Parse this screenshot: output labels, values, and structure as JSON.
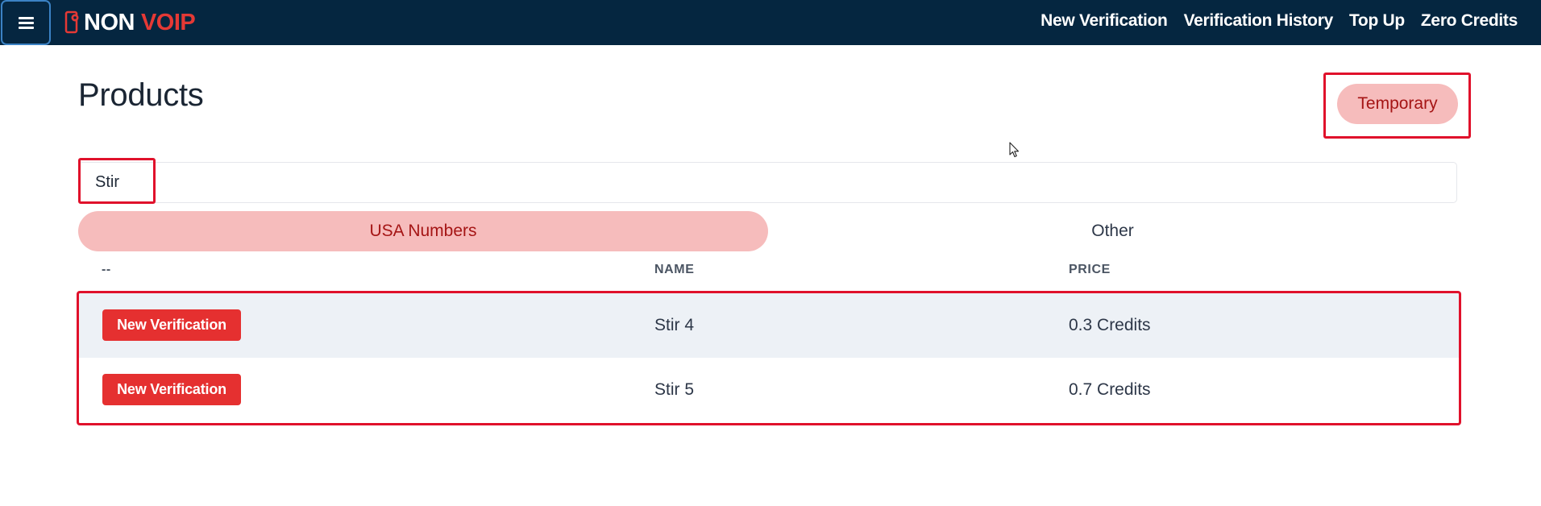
{
  "topbar": {
    "logo": {
      "part1": "NON",
      "part2": "VOIP"
    },
    "nav": [
      {
        "label": "New Verification"
      },
      {
        "label": "Verification History"
      },
      {
        "label": "Top Up"
      },
      {
        "label": "Zero Credits"
      }
    ]
  },
  "main": {
    "title": "Products",
    "mode_button": "Temporary",
    "search": {
      "value": "Stir",
      "placeholder": ""
    },
    "tabs": [
      {
        "label": "USA Numbers",
        "active": true
      },
      {
        "label": "Other",
        "active": false
      }
    ],
    "table": {
      "headers": [
        "--",
        "NAME",
        "PRICE"
      ],
      "rows": [
        {
          "action": "New Verification",
          "name": "Stir 4",
          "price": "0.3 Credits"
        },
        {
          "action": "New Verification",
          "name": "Stir 5",
          "price": "0.7 Credits"
        }
      ]
    }
  },
  "icons": {
    "menu": "hamburger-menu-icon",
    "logo": "phone-logo-icon",
    "cursor": "mouse-pointer-icon"
  },
  "colors": {
    "topbar_bg": "#052640",
    "accent_red": "#e53030",
    "pill_bg": "#f6bcbc",
    "pill_text": "#a51515",
    "highlight_border": "#e0112b",
    "row_alt_bg": "#edf1f6"
  }
}
